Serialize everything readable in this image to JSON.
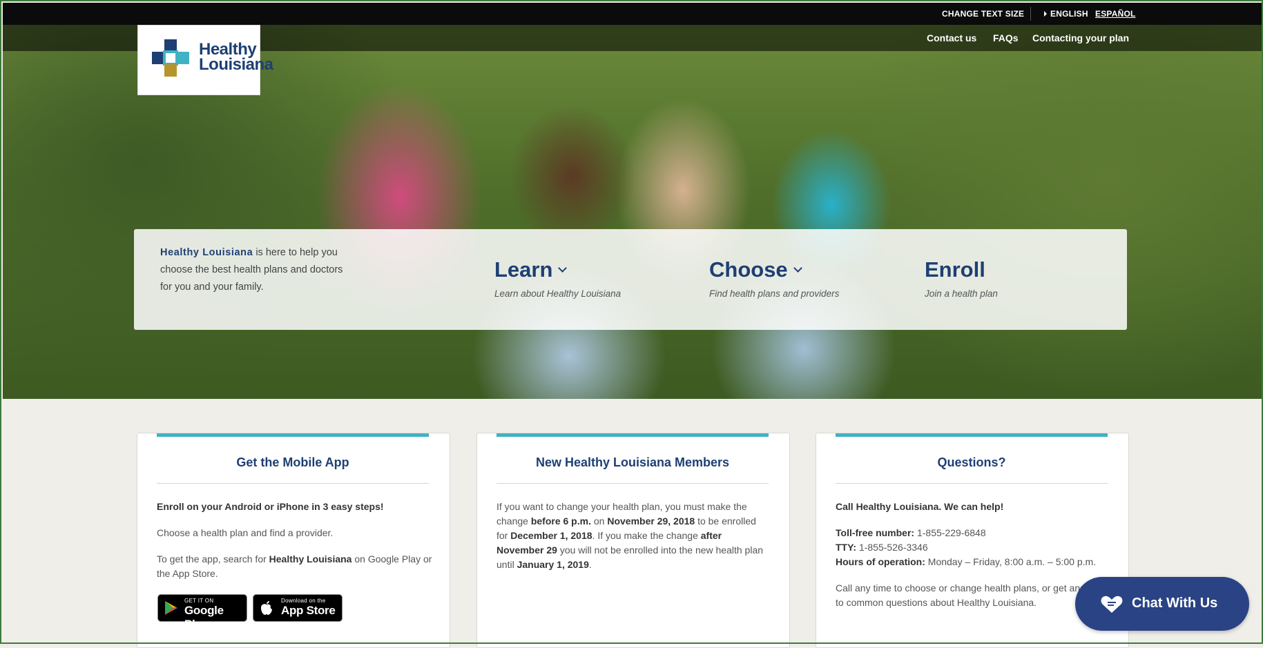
{
  "utility_bar": {
    "change_text_size": "CHANGE TEXT SIZE",
    "english": "ENGLISH",
    "espanol": "ESPAÑOL"
  },
  "header": {
    "logo_line1": "Healthy",
    "logo_line2": "Louisiana",
    "nav": [
      "Contact us",
      "FAQs",
      "Contacting your plan"
    ]
  },
  "hero_panel": {
    "intro_brand": "Healthy Louisiana",
    "intro_rest": " is here to help you choose the best health plans and doctors for you and your family.",
    "steps": [
      {
        "title": "Learn",
        "subtitle": "Learn about Healthy Louisiana",
        "has_dropdown": true
      },
      {
        "title": "Choose",
        "subtitle": "Find health plans and providers",
        "has_dropdown": true
      },
      {
        "title": "Enroll",
        "subtitle": "Join a health plan",
        "has_dropdown": false
      }
    ]
  },
  "cards": {
    "mobile_app": {
      "title": "Get the Mobile App",
      "p1": "Enroll on your Android or iPhone in 3 easy steps!",
      "p2": "Choose a health plan and find a provider.",
      "p3_pre": "To get the app, search for ",
      "p3_bold": "Healthy Louisiana",
      "p3_post": " on Google Play or the App Store.",
      "google_small": "GET IT ON",
      "google_big": "Google Play",
      "apple_small": "Download on the",
      "apple_big": "App Store"
    },
    "new_members": {
      "title": "New Healthy Louisiana Members",
      "t1": "If you want to change your health plan, you must make the change ",
      "b1": "before 6 p.m.",
      "t2": " on ",
      "b2": "November 29, 2018",
      "t3": " to be enrolled for ",
      "b3": "December 1, 2018",
      "t4": ". If you make the change ",
      "b4": "after November 29",
      "t5": " you will not be enrolled into the new health plan until ",
      "b5": "January 1, 2019",
      "t6": "."
    },
    "questions": {
      "title": "Questions?",
      "call": "Call Healthy Louisiana.  We can help!",
      "tollfree_label": "Toll-free number:",
      "tollfree": " 1-855-229-6848",
      "tty_label": "TTY:",
      "tty": " 1-855-526-3346",
      "hours_label": "Hours of operation:",
      "hours": " Monday – Friday, 8:00 a.m. – 5:00 p.m.",
      "p3": "Call any time to choose or change health plans, or get answers to common questions about Healthy Louisiana."
    }
  },
  "chat": {
    "label": "Chat With Us",
    "icon": "heart-chat-icon"
  },
  "colors": {
    "brand_navy": "#1e3f73",
    "accent_teal": "#3fb3c4",
    "chat_blue": "#2a4385"
  }
}
